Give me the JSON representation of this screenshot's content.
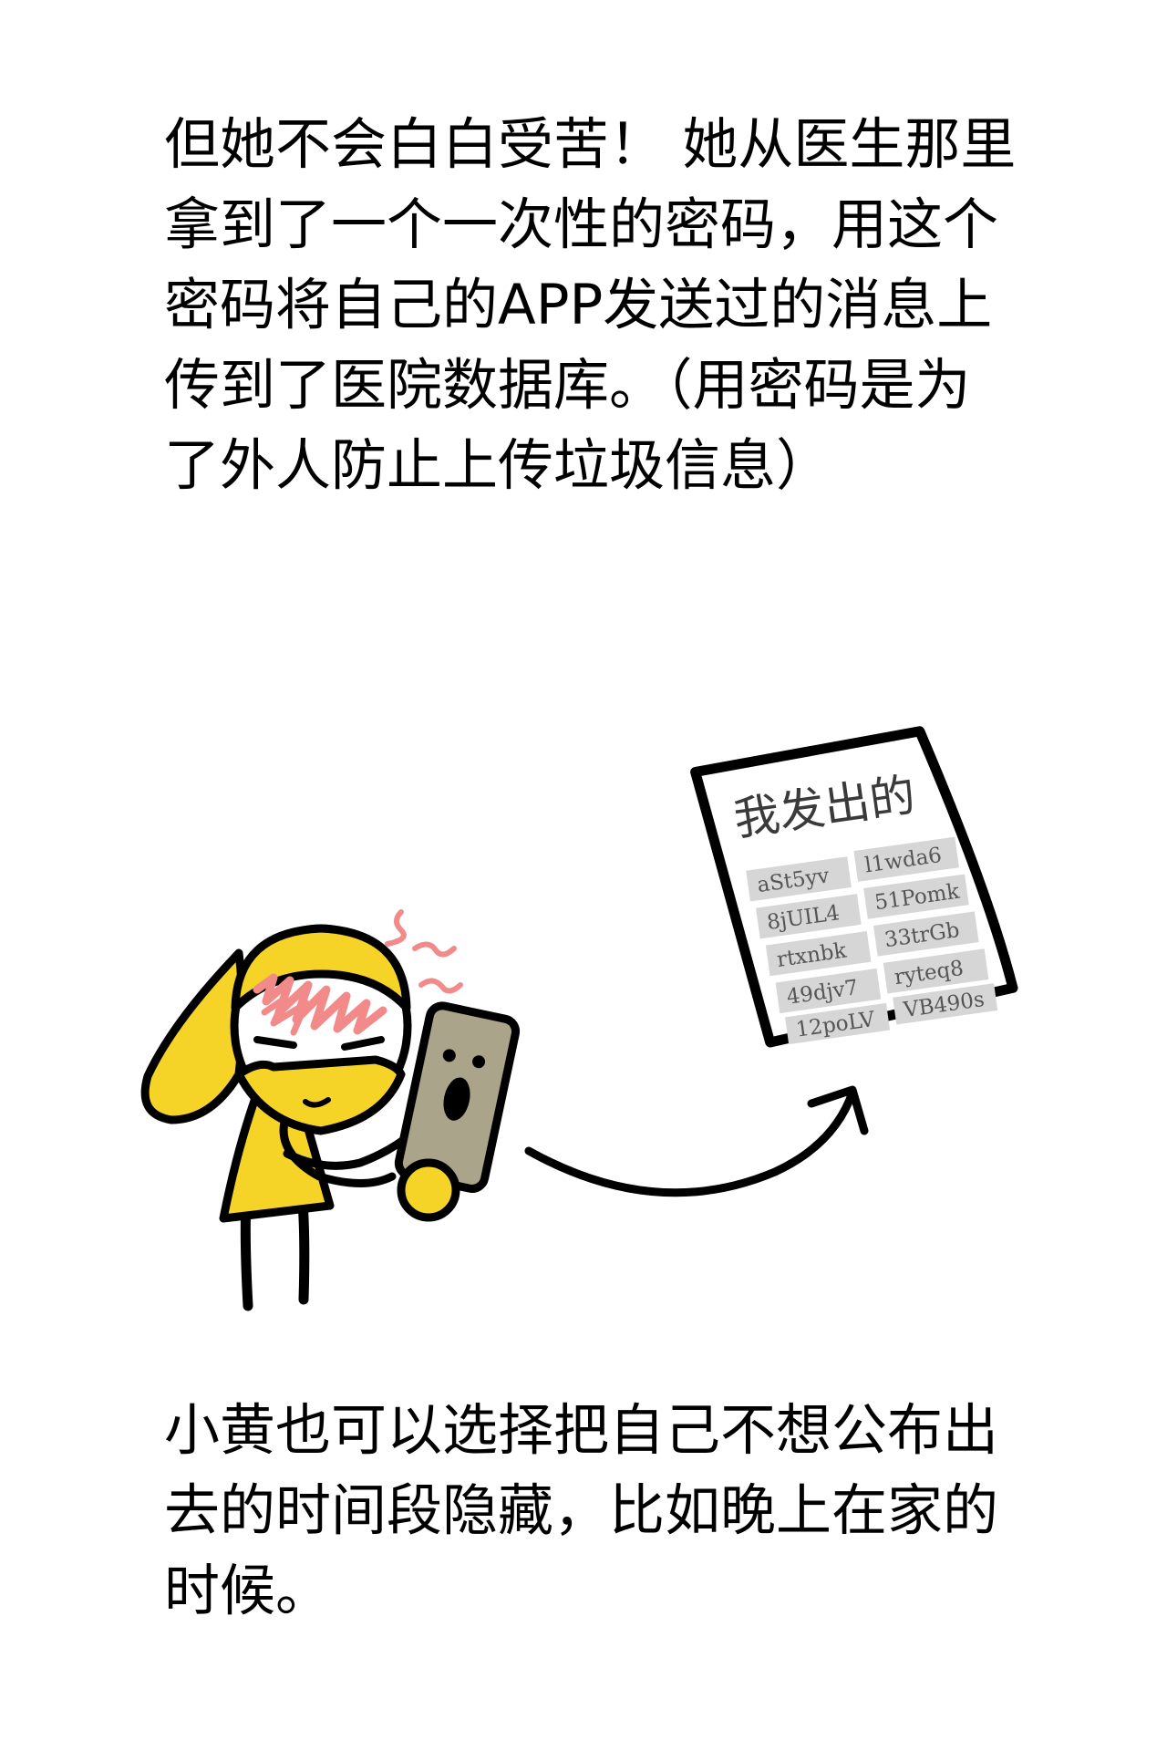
{
  "captions": {
    "top": "但她不会白白受苦！ 她从医生那里拿到了一个一次性的密码，用这个密码将自己的APP发送过的消息上传到了医院数据库。（用密码是为了外人防止上传垃圾信息）",
    "bottom": "小黄也可以选择把自己不想公布出去的时间段隐藏，比如晚上在家的时候。"
  },
  "paper": {
    "title": "我发出的",
    "codes_left": [
      "aSt5yv",
      "8jUIL4",
      "rtxnbk",
      "49djv7",
      "12poLV"
    ],
    "codes_right": [
      "l1wda6",
      "51Pomk",
      "33trGb",
      "ryteq8",
      "VB490s"
    ]
  },
  "colors": {
    "character_yellow": "#f5d327",
    "phone_gray": "#a9a48a",
    "fever_pink": "#f28a8a",
    "code_box": "#d6d6d6",
    "ink": "#000000"
  },
  "icons": {
    "phone": "phone-icon",
    "arrow": "curved-arrow-icon",
    "paper": "document-icon"
  }
}
